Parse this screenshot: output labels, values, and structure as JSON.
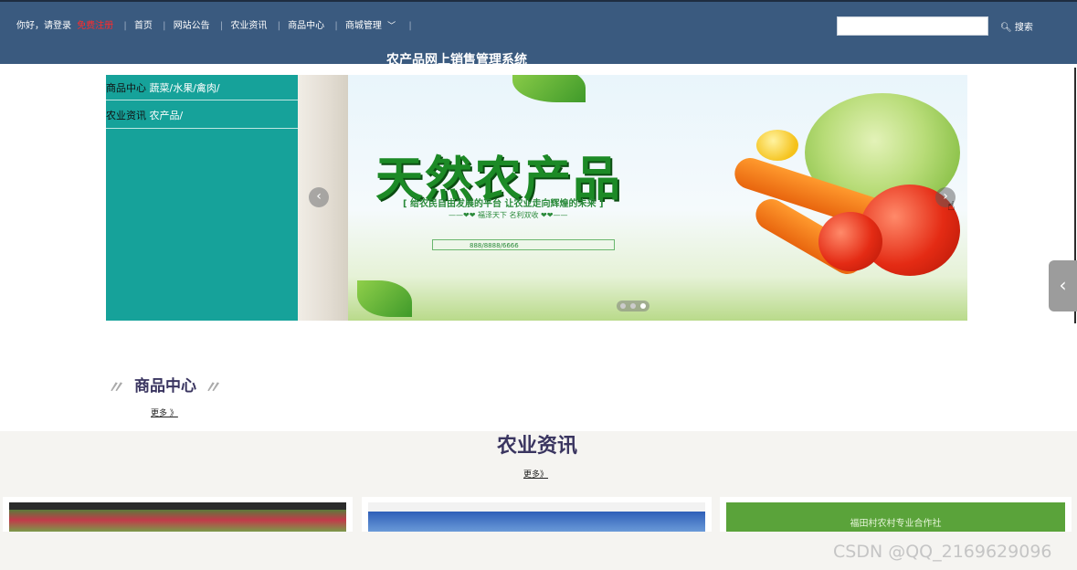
{
  "nav": {
    "greeting": "你好，请登录",
    "register": "免费注册",
    "items": [
      "首页",
      "网站公告",
      "农业资讯",
      "商品中心",
      "商城管理"
    ]
  },
  "search": {
    "placeholder": "",
    "button": "搜索"
  },
  "site_title": "农产品网上销售管理系统",
  "side_menu": [
    {
      "label": "商品中心",
      "links": "蔬菜/水果/禽肉/"
    },
    {
      "label": "农业资讯",
      "links": "农产品/"
    }
  ],
  "banner": {
    "headline": "天然农产品",
    "tagline": "[ 给农民自由发展的平台  让农业走向辉煌的未来 ]",
    "slogan": "——❤❤ 福泽天下  名利双收 ❤❤——",
    "phone": "888/8888/6666"
  },
  "products": {
    "title": "商品中心",
    "more": "更多 》"
  },
  "news": {
    "title": "农业资讯",
    "more": "更多》",
    "card3_caption": "福田村农村专业合作社"
  },
  "watermark": "CSDN @QQ_2169629096",
  "colors": {
    "header": "#3a5a7f",
    "side_panel": "#16a29a",
    "register": "#ff2b2b",
    "title": "#3a3560"
  }
}
